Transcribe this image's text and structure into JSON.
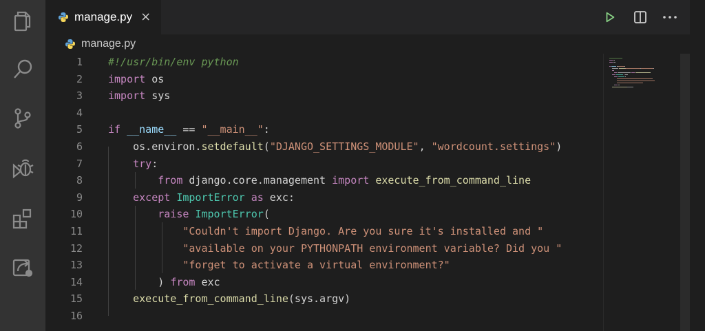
{
  "activity_bar": {
    "icons": [
      "files-icon",
      "search-icon",
      "source-control-icon",
      "debug-icon",
      "extensions-icon",
      "remote-explorer-icon"
    ]
  },
  "tab": {
    "label": "manage.py",
    "close_glyph": "×"
  },
  "toolbar": {
    "run_icon": "run-icon",
    "split_icon": "split-editor-icon",
    "more_icon": "more-actions-icon"
  },
  "breadcrumb": {
    "file": "manage.py"
  },
  "code": {
    "line_numbers": [
      "1",
      "2",
      "3",
      "4",
      "5",
      "6",
      "7",
      "8",
      "9",
      "10",
      "11",
      "12",
      "13",
      "14",
      "15",
      "16"
    ],
    "lines": [
      [
        {
          "t": "cmt",
          "v": "#!/usr/bin/env python"
        }
      ],
      [
        {
          "t": "kw",
          "v": "import"
        },
        {
          "t": "plain",
          "v": " os"
        }
      ],
      [
        {
          "t": "kw",
          "v": "import"
        },
        {
          "t": "plain",
          "v": " sys"
        }
      ],
      [],
      [
        {
          "t": "kw",
          "v": "if"
        },
        {
          "t": "plain",
          "v": " "
        },
        {
          "t": "var",
          "v": "__name__"
        },
        {
          "t": "plain",
          "v": " == "
        },
        {
          "t": "str",
          "v": "\"__main__\""
        },
        {
          "t": "plain",
          "v": ":"
        }
      ],
      [
        {
          "t": "plain",
          "v": "    os.environ."
        },
        {
          "t": "fn",
          "v": "setdefault"
        },
        {
          "t": "plain",
          "v": "("
        },
        {
          "t": "str",
          "v": "\"DJANGO_SETTINGS_MODULE\""
        },
        {
          "t": "plain",
          "v": ", "
        },
        {
          "t": "str",
          "v": "\"wordcount.settings\""
        },
        {
          "t": "plain",
          "v": ")"
        }
      ],
      [
        {
          "t": "plain",
          "v": "    "
        },
        {
          "t": "kw",
          "v": "try"
        },
        {
          "t": "plain",
          "v": ":"
        }
      ],
      [
        {
          "t": "plain",
          "v": "        "
        },
        {
          "t": "kw",
          "v": "from"
        },
        {
          "t": "plain",
          "v": " django.core.management "
        },
        {
          "t": "kw",
          "v": "import"
        },
        {
          "t": "plain",
          "v": " "
        },
        {
          "t": "fn",
          "v": "execute_from_command_line"
        }
      ],
      [
        {
          "t": "plain",
          "v": "    "
        },
        {
          "t": "kw",
          "v": "except"
        },
        {
          "t": "plain",
          "v": " "
        },
        {
          "t": "cls",
          "v": "ImportError"
        },
        {
          "t": "plain",
          "v": " "
        },
        {
          "t": "kw",
          "v": "as"
        },
        {
          "t": "plain",
          "v": " exc:"
        }
      ],
      [
        {
          "t": "plain",
          "v": "        "
        },
        {
          "t": "kw",
          "v": "raise"
        },
        {
          "t": "plain",
          "v": " "
        },
        {
          "t": "cls",
          "v": "ImportError"
        },
        {
          "t": "plain",
          "v": "("
        }
      ],
      [
        {
          "t": "plain",
          "v": "            "
        },
        {
          "t": "str",
          "v": "\"Couldn't import Django. Are you sure it's installed and \""
        }
      ],
      [
        {
          "t": "plain",
          "v": "            "
        },
        {
          "t": "str",
          "v": "\"available on your PYTHONPATH environment variable? Did you \""
        }
      ],
      [
        {
          "t": "plain",
          "v": "            "
        },
        {
          "t": "str",
          "v": "\"forget to activate a virtual environment?\""
        }
      ],
      [
        {
          "t": "plain",
          "v": "        ) "
        },
        {
          "t": "kw",
          "v": "from"
        },
        {
          "t": "plain",
          "v": " exc"
        }
      ],
      [
        {
          "t": "plain",
          "v": "    "
        },
        {
          "t": "fn",
          "v": "execute_from_command_line"
        },
        {
          "t": "plain",
          "v": "(sys.argv)"
        }
      ],
      []
    ]
  },
  "colors": {
    "background": "#1e1e1e",
    "activity_bar": "#333333",
    "keyword": "#c586c0",
    "string": "#ce9178",
    "comment": "#6a9955",
    "class": "#4ec9b0",
    "function": "#dcdcaa",
    "run_green": "#89d185"
  }
}
